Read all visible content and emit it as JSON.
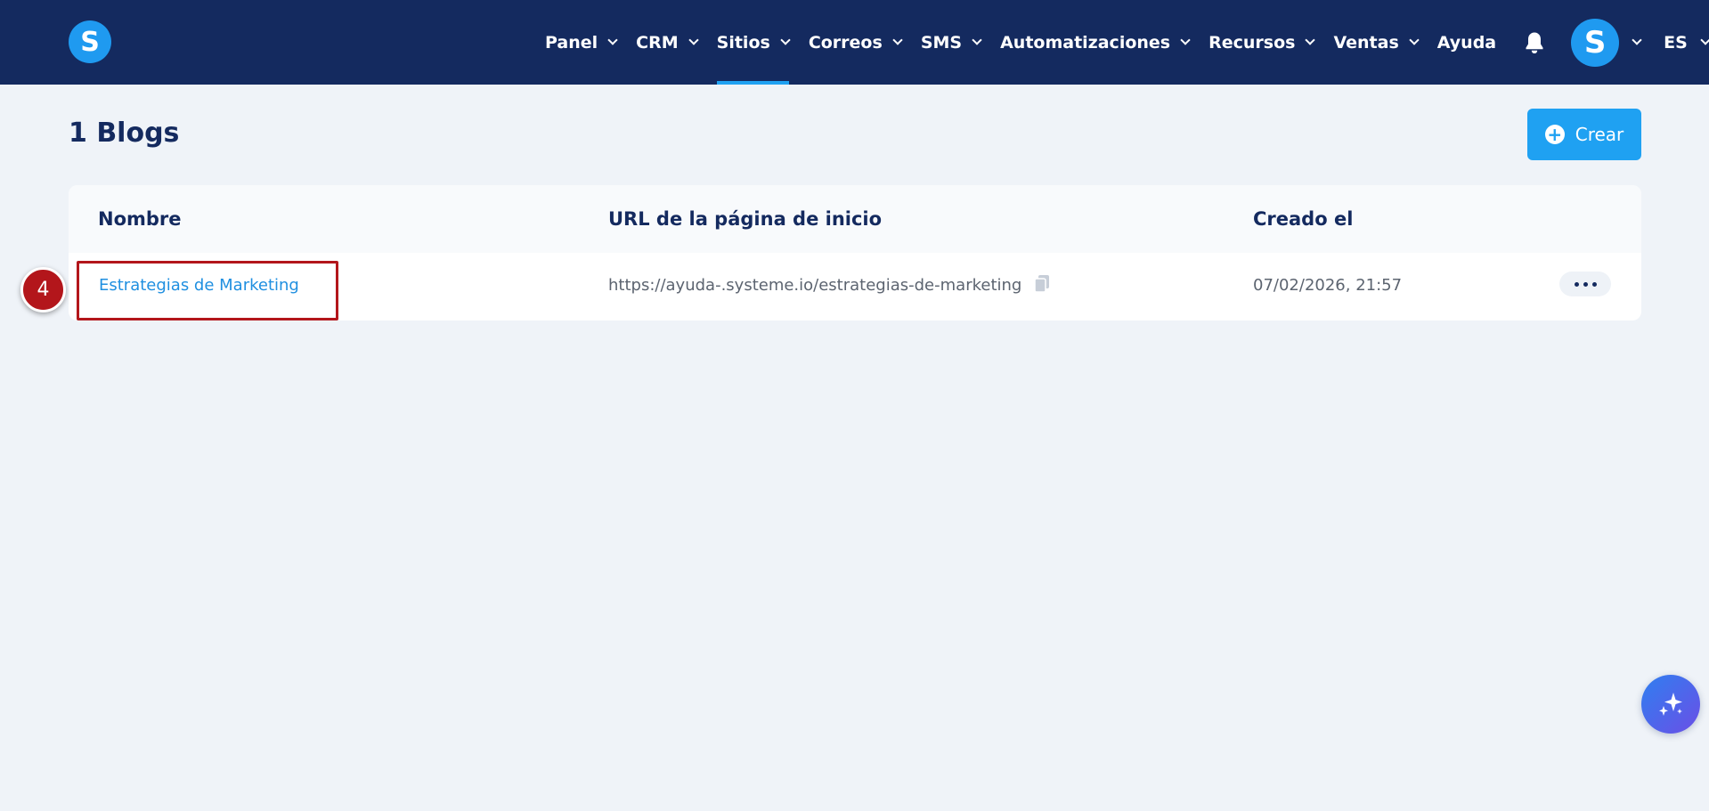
{
  "brand": {
    "logo_letter": "S",
    "primary_color": "#142a5f",
    "accent_color": "#1fa1f2"
  },
  "nav": {
    "items": [
      {
        "label": "Panel",
        "has_dropdown": true
      },
      {
        "label": "CRM",
        "has_dropdown": true
      },
      {
        "label": "Sitios",
        "has_dropdown": true,
        "active": true
      },
      {
        "label": "Correos",
        "has_dropdown": true
      },
      {
        "label": "SMS",
        "has_dropdown": true
      },
      {
        "label": "Automatizaciones",
        "has_dropdown": true
      },
      {
        "label": "Recursos",
        "has_dropdown": true
      },
      {
        "label": "Ventas",
        "has_dropdown": true
      },
      {
        "label": "Ayuda",
        "has_dropdown": false
      }
    ],
    "notification_icon": "bell-icon",
    "avatar_letter": "S",
    "language": "ES"
  },
  "page": {
    "title": "1 Blogs",
    "create_label": "Crear"
  },
  "table": {
    "columns": [
      "Nombre",
      "URL de la página de inicio",
      "Creado el"
    ],
    "rows": [
      {
        "name": "Estrategias de Marketing",
        "url": "https://ayuda-.systeme.io/estrategias-de-marketing",
        "created": "07/02/2026, 21:57"
      }
    ]
  },
  "annotation": {
    "step_number": "4",
    "color": "#b3161b"
  }
}
